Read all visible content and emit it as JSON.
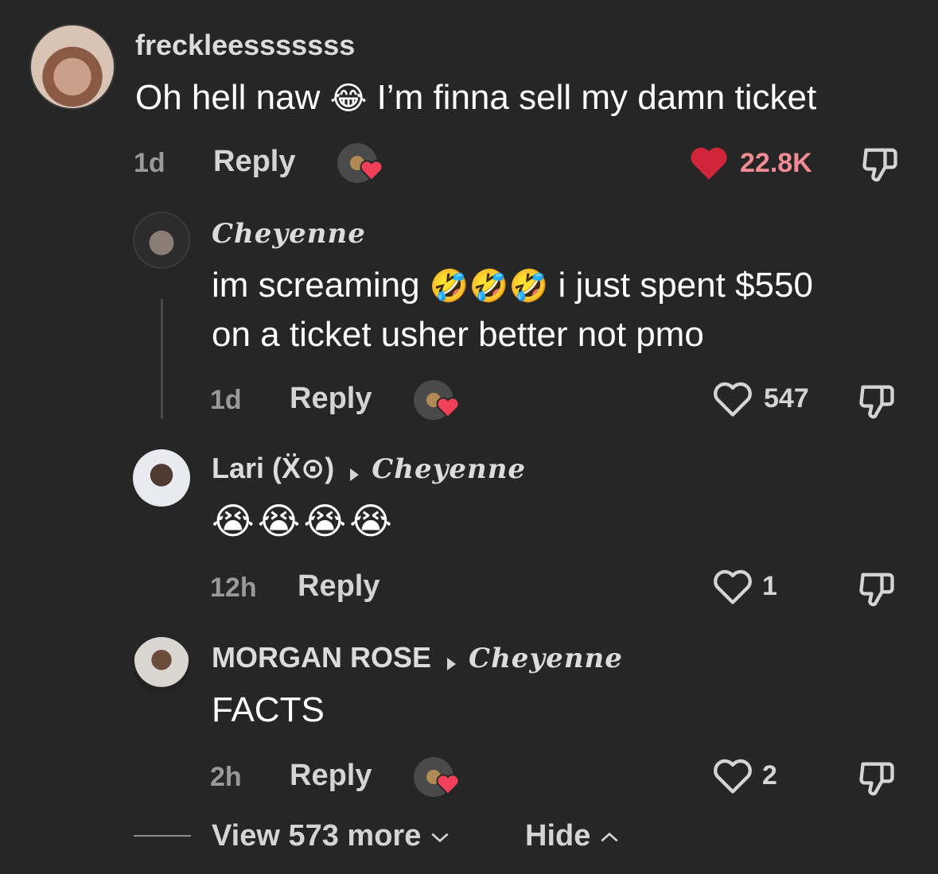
{
  "comments": [
    {
      "username": "freckleesssssss",
      "text_before": "Oh hell naw",
      "emoji_1": "😂",
      "text_after": "I’m finna sell my damn ticket",
      "time": "1d",
      "reply_label": "Reply",
      "likes": "22.8K",
      "liked": true
    },
    {
      "username": "Cheyenne",
      "line1_text": "im screaming",
      "emojis": "🤣🤣🤣",
      "line1_after": "i just spent $550",
      "line2": "on a ticket usher better not pmo",
      "time": "1d",
      "reply_label": "Reply",
      "likes": "547"
    },
    {
      "username": "Lari (Ẍ⊙)",
      "reply_to": "Cheyenne",
      "emojis": "😭😭😭😭",
      "time": "12h",
      "reply_label": "Reply",
      "likes": "1"
    },
    {
      "username": "MORGAN ROSE",
      "reply_to": "Cheyenne",
      "text": "FACTS",
      "time": "2h",
      "reply_label": "Reply",
      "likes": "2"
    }
  ],
  "footer": {
    "view_more": "View 573 more",
    "hide": "Hide"
  },
  "icons": {
    "heart_filled_color": "#d0253b",
    "creator_heart_color": "#f0405a",
    "dislike": "dislike-icon",
    "heart_outline": "heart-outline-icon"
  }
}
